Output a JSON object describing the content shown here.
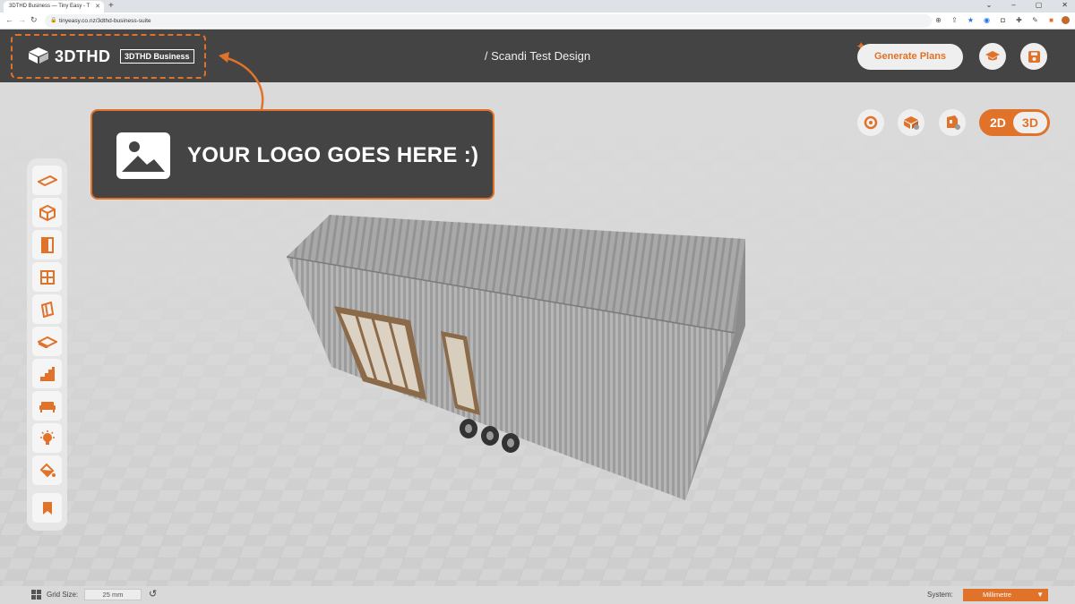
{
  "browser": {
    "tab_title": "3DTHD Business — Tiny Easy - T",
    "tab_close": "✕",
    "new_tab": "+",
    "url": "tinyeasy.co.nz/3dthd-business-suite",
    "window_controls": [
      "⌄",
      "–",
      "▢",
      "✕"
    ]
  },
  "header": {
    "logo_text": "3DTHD",
    "logo_badge": "3DTHD Business",
    "design_title": "/ Scandi Test Design",
    "generate_plans_label": "Generate Plans",
    "icons": [
      "graduation-cap-icon",
      "save-icon"
    ]
  },
  "callout": {
    "text": "YOUR LOGO GOES HERE :)"
  },
  "view_controls": {
    "toggle_2d": "2D",
    "toggle_3d": "3D",
    "active_mode": "3D"
  },
  "left_toolbar": {
    "tools": [
      "floor-tool",
      "walls-tool",
      "doors-tool",
      "windows-tool",
      "cladding-tool",
      "roof-tool",
      "stairs-tool",
      "furniture-tool",
      "lighting-tool",
      "paint-tool",
      "bookmark-tool"
    ]
  },
  "statusbar": {
    "grid_size_label": "Grid Size:",
    "grid_size_value": "25 mm",
    "system_label": "System:",
    "system_value": "Millimetre"
  },
  "colors": {
    "accent": "#e0722a",
    "header_bg": "#444444",
    "canvas_bg": "#d6d6d6"
  }
}
